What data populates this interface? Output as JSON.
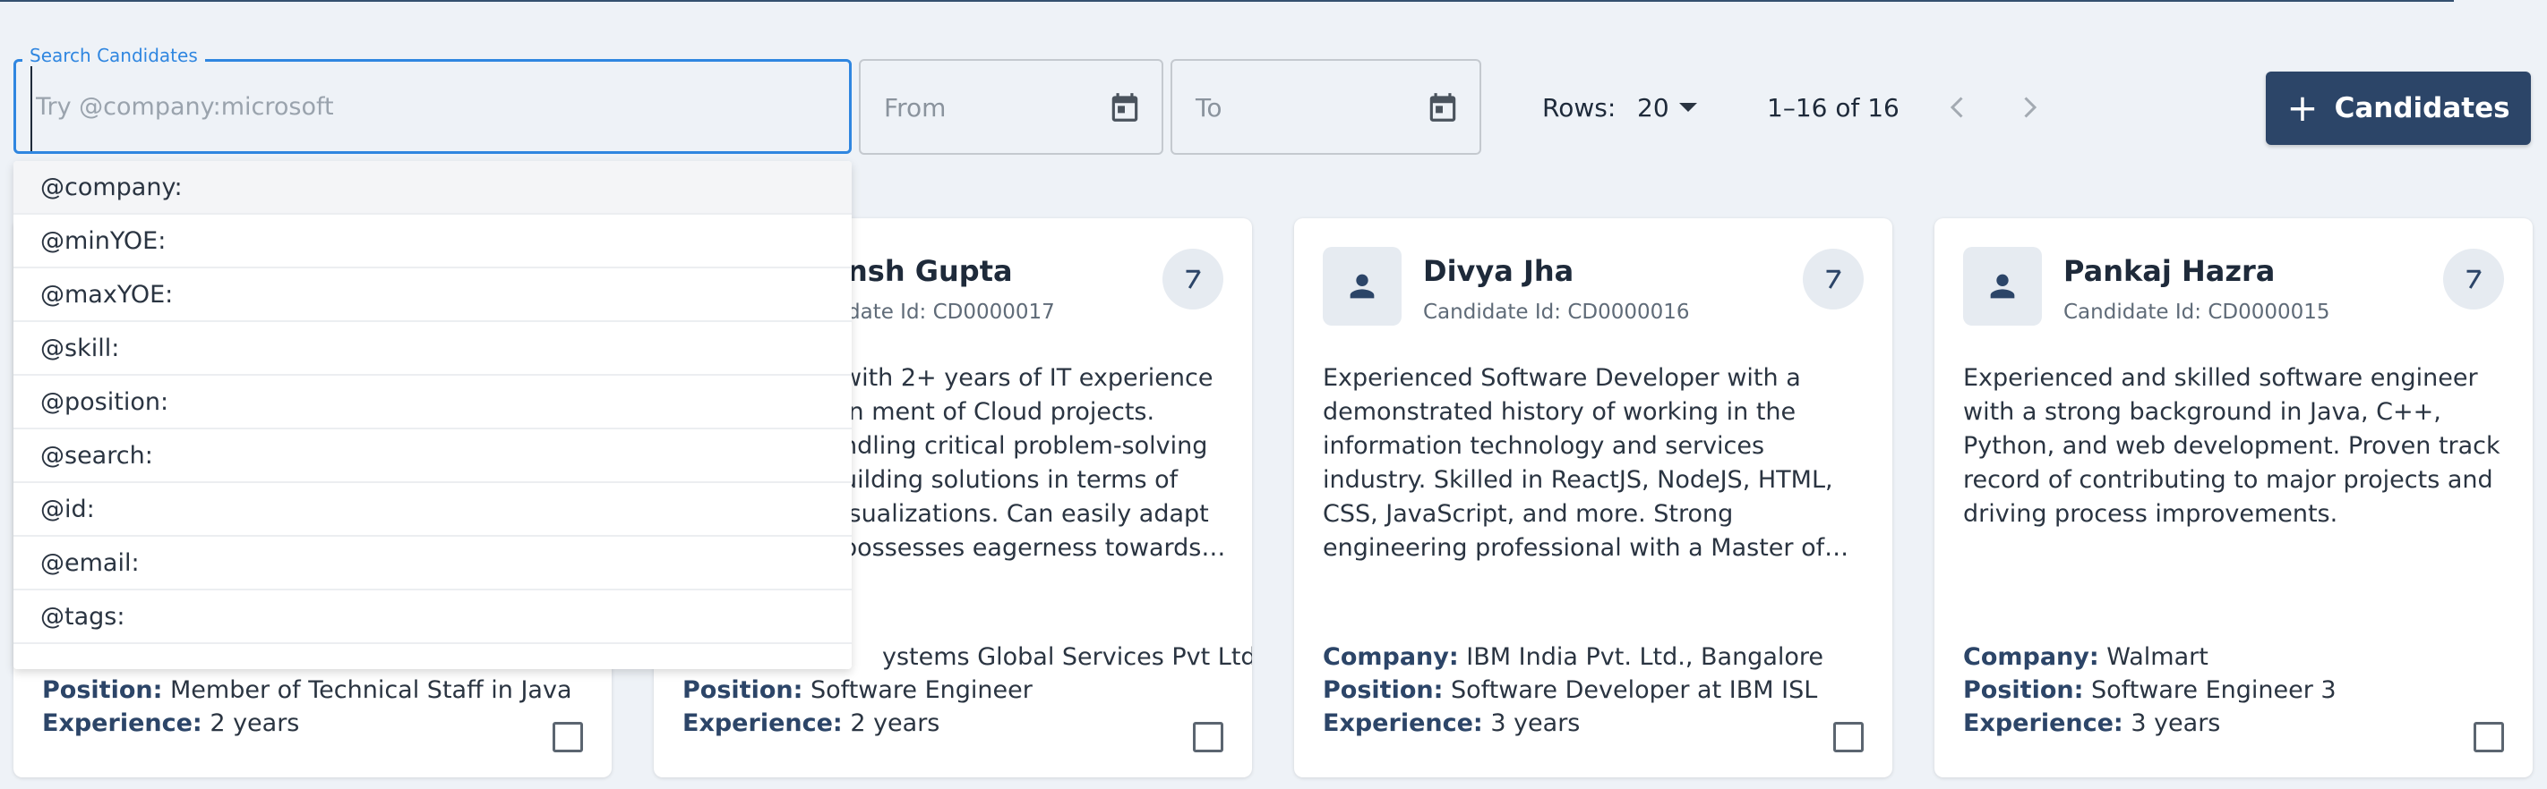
{
  "search": {
    "label": "Search Candidates",
    "placeholder": "Try @company:microsoft",
    "value": "",
    "suggestions": [
      "@company:",
      "@minYOE:",
      "@maxYOE:",
      "@skill:",
      "@position:",
      "@search:",
      "@id:",
      "@email:",
      "@tags:"
    ]
  },
  "filters": {
    "from_placeholder": "From",
    "to_placeholder": "To"
  },
  "pagination": {
    "rows_label": "Rows:",
    "rows_value": "20",
    "range": "1–16 of 16"
  },
  "actions": {
    "add_label": "Candidates"
  },
  "labels": {
    "company": "Company:",
    "position": "Position:",
    "experience": "Experience:"
  },
  "cards": [
    {
      "name": "",
      "id": "",
      "summary": "",
      "company": "",
      "position": "Member of Technical Staff in Java",
      "experience": "2 years"
    },
    {
      "name": "nsh Gupta",
      "id": "date Id: CD0000017",
      "summary": "with 2+ years of IT experience in ment of Cloud projects. ndling critical problem-solving uilding solutions in terms of isualizations. Can easily adapt possesses eagerness towards…",
      "company": "ystems Global Services Pvt Ltd",
      "position": "Software Engineer",
      "experience": "2 years"
    },
    {
      "name": "Divya Jha",
      "id": "Candidate Id: CD0000016",
      "summary": "Experienced Software Developer with a demonstrated history of working in the information technology and services industry. Skilled in ReactJS, NodeJS, HTML, CSS, JavaScript, and more. Strong engineering professional with a Master of Technology -…",
      "company": "IBM India Pvt. Ltd., Bangalore",
      "position": "Software Developer at IBM ISL",
      "experience": "3 years"
    },
    {
      "name": "Pankaj Hazra",
      "id": "Candidate Id: CD0000015",
      "summary": "Experienced and skilled software engineer with a strong background in Java, C++, Python, and web development. Proven track record of contributing to major projects and driving process improvements.",
      "company": "Walmart",
      "position": "Software Engineer 3",
      "experience": "3 years"
    }
  ]
}
